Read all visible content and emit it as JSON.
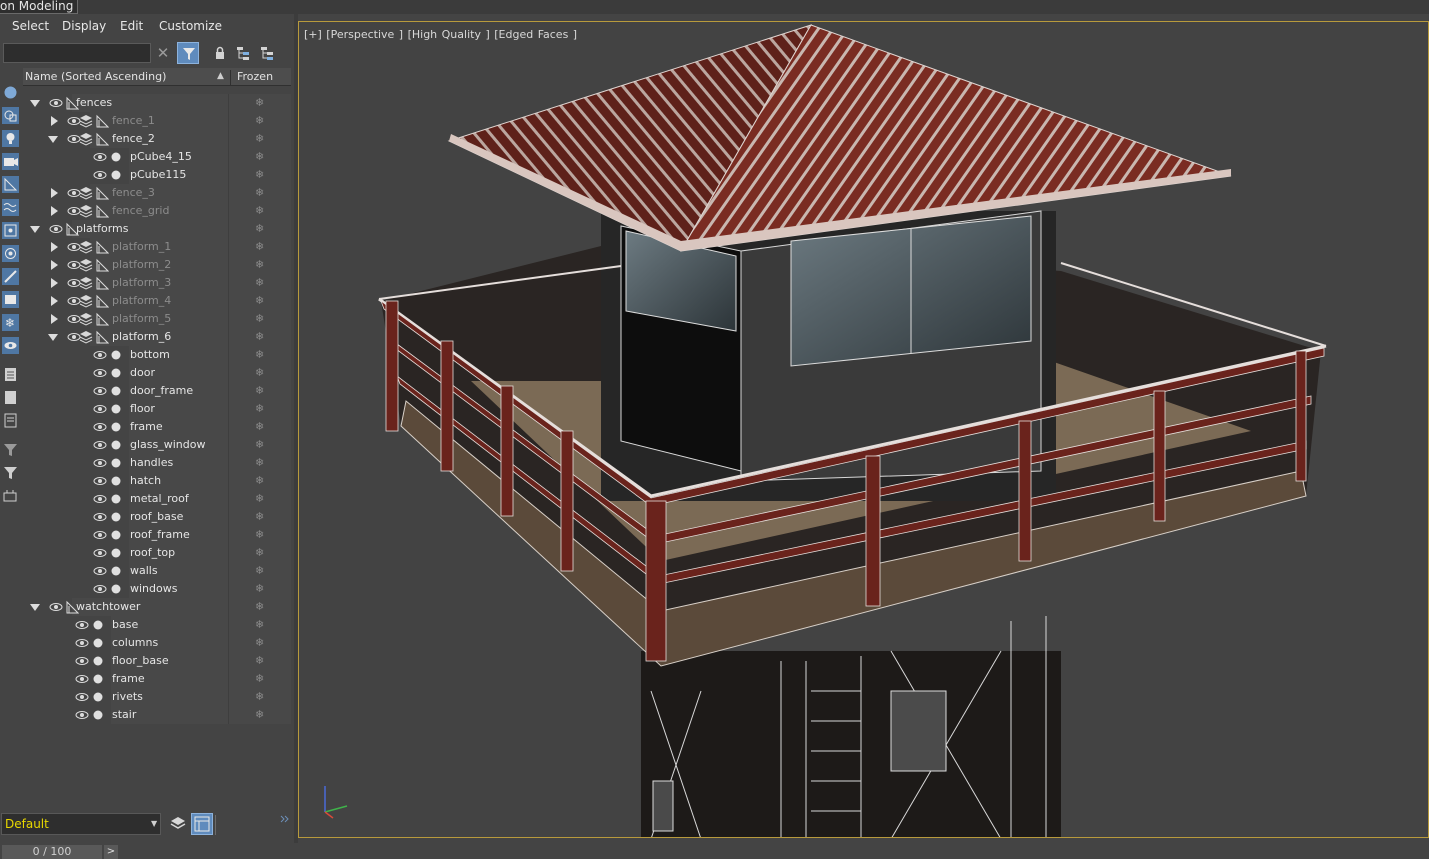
{
  "window": {
    "tab_title": "on Modeling"
  },
  "menu": [
    "Select",
    "Display",
    "Edit",
    "Customize"
  ],
  "scene_explorer": {
    "search_placeholder": "",
    "columns": {
      "name": "Name (Sorted Ascending)",
      "frozen": "Frozen"
    },
    "rows": [
      {
        "label": "fences",
        "depth": 0,
        "expand": "open",
        "kind": "layer",
        "dim": false
      },
      {
        "label": "fence_1",
        "depth": 1,
        "expand": "closed",
        "kind": "group",
        "dim": true
      },
      {
        "label": "fence_2",
        "depth": 1,
        "expand": "open",
        "kind": "group",
        "dim": false
      },
      {
        "label": "pCube4_15",
        "depth": 2,
        "expand": "none",
        "kind": "object",
        "dim": false
      },
      {
        "label": "pCube115",
        "depth": 2,
        "expand": "none",
        "kind": "object",
        "dim": false
      },
      {
        "label": "fence_3",
        "depth": 1,
        "expand": "closed",
        "kind": "group",
        "dim": true
      },
      {
        "label": "fence_grid",
        "depth": 1,
        "expand": "closed",
        "kind": "group",
        "dim": true
      },
      {
        "label": "platforms",
        "depth": 0,
        "expand": "open",
        "kind": "layer",
        "dim": false
      },
      {
        "label": "platform_1",
        "depth": 1,
        "expand": "closed",
        "kind": "group",
        "dim": true
      },
      {
        "label": "platform_2",
        "depth": 1,
        "expand": "closed",
        "kind": "group",
        "dim": true
      },
      {
        "label": "platform_3",
        "depth": 1,
        "expand": "closed",
        "kind": "group",
        "dim": true
      },
      {
        "label": "platform_4",
        "depth": 1,
        "expand": "closed",
        "kind": "group",
        "dim": true
      },
      {
        "label": "platform_5",
        "depth": 1,
        "expand": "closed",
        "kind": "group",
        "dim": true
      },
      {
        "label": "platform_6",
        "depth": 1,
        "expand": "open",
        "kind": "group",
        "dim": false
      },
      {
        "label": "bottom",
        "depth": 2,
        "expand": "none",
        "kind": "object",
        "dim": false
      },
      {
        "label": "door",
        "depth": 2,
        "expand": "none",
        "kind": "object",
        "dim": false
      },
      {
        "label": "door_frame",
        "depth": 2,
        "expand": "none",
        "kind": "object",
        "dim": false
      },
      {
        "label": "floor",
        "depth": 2,
        "expand": "none",
        "kind": "object",
        "dim": false
      },
      {
        "label": "frame",
        "depth": 2,
        "expand": "none",
        "kind": "object",
        "dim": false
      },
      {
        "label": "glass_window",
        "depth": 2,
        "expand": "none",
        "kind": "object",
        "dim": false
      },
      {
        "label": "handles",
        "depth": 2,
        "expand": "none",
        "kind": "object",
        "dim": false
      },
      {
        "label": "hatch",
        "depth": 2,
        "expand": "none",
        "kind": "object",
        "dim": false
      },
      {
        "label": "metal_roof",
        "depth": 2,
        "expand": "none",
        "kind": "object",
        "dim": false
      },
      {
        "label": "roof_base",
        "depth": 2,
        "expand": "none",
        "kind": "object",
        "dim": false
      },
      {
        "label": "roof_frame",
        "depth": 2,
        "expand": "none",
        "kind": "object",
        "dim": false
      },
      {
        "label": "roof_top",
        "depth": 2,
        "expand": "none",
        "kind": "object",
        "dim": false
      },
      {
        "label": "walls",
        "depth": 2,
        "expand": "none",
        "kind": "object",
        "dim": false
      },
      {
        "label": "windows",
        "depth": 2,
        "expand": "none",
        "kind": "object",
        "dim": false
      },
      {
        "label": "watchtower",
        "depth": 0,
        "expand": "open",
        "kind": "layer",
        "dim": false
      },
      {
        "label": "base",
        "depth": 1,
        "expand": "none",
        "kind": "object",
        "dim": false
      },
      {
        "label": "columns",
        "depth": 1,
        "expand": "none",
        "kind": "object",
        "dim": false
      },
      {
        "label": "floor_base",
        "depth": 1,
        "expand": "none",
        "kind": "object",
        "dim": false
      },
      {
        "label": "frame",
        "depth": 1,
        "expand": "none",
        "kind": "object",
        "dim": false
      },
      {
        "label": "rivets",
        "depth": 1,
        "expand": "none",
        "kind": "object",
        "dim": false
      },
      {
        "label": "stair",
        "depth": 1,
        "expand": "none",
        "kind": "object",
        "dim": false
      }
    ]
  },
  "layer_dropdown": {
    "value": "Default"
  },
  "timeline": {
    "frame_display": "0 / 100",
    "next_label": ">"
  },
  "viewport": {
    "label": "[+] [Perspective ] [High Quality ] [Edged Faces ]",
    "border_color": "#b89a3c",
    "subject": "wooden watchtower with metal roof and railed platform"
  },
  "colors": {
    "panel_bg": "#444444",
    "active_button": "#5f8bbd",
    "dim_text": "#8c8c8c",
    "layer_value": "#e8d800"
  }
}
